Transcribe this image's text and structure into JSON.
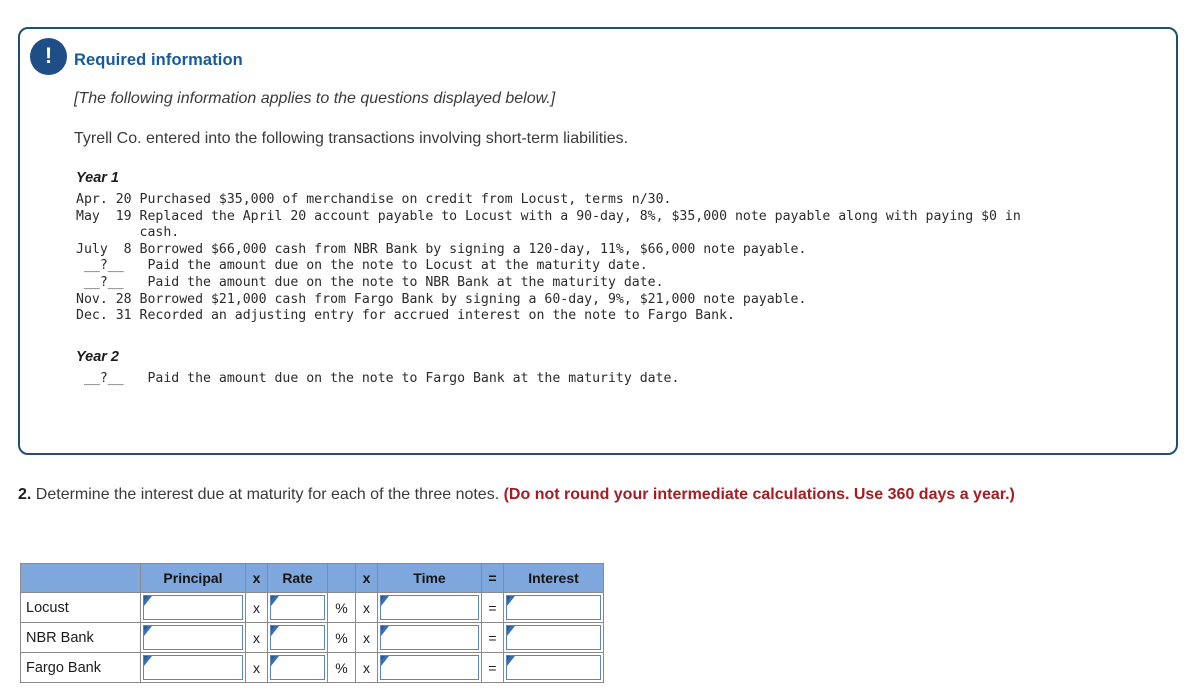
{
  "panel": {
    "alert_icon": "exclamation-icon",
    "heading": "Required information",
    "applies_note": "[The following information applies to the questions displayed below.]",
    "intro": "Tyrell Co. entered into the following transactions involving short-term liabilities.",
    "year1_heading": "Year 1",
    "year1_transactions": "Apr. 20 Purchased $35,000 of merchandise on credit from Locust, terms n/30.\nMay  19 Replaced the April 20 account payable to Locust with a 90-day, 8%, $35,000 note payable along with paying $0 in\n        cash.\nJuly  8 Borrowed $66,000 cash from NBR Bank by signing a 120-day, 11%, $66,000 note payable.\n __?__   Paid the amount due on the note to Locust at the maturity date.\n __?__   Paid the amount due on the note to NBR Bank at the maturity date.\nNov. 28 Borrowed $21,000 cash from Fargo Bank by signing a 60-day, 9%, $21,000 note payable.\nDec. 31 Recorded an adjusting entry for accrued interest on the note to Fargo Bank.",
    "year2_heading": "Year 2",
    "year2_transactions": " __?__   Paid the amount due on the note to Fargo Bank at the maturity date."
  },
  "question": {
    "number": "2.",
    "text": " Determine the interest due at maturity for each of the three notes. ",
    "hint": "(Do not round your intermediate calculations. Use 360 days a year.)"
  },
  "table": {
    "headers": {
      "row_label": "",
      "principal": "Principal",
      "times1": "x",
      "rate": "Rate",
      "percent": "",
      "times2": "x",
      "time": "Time",
      "equals": "=",
      "interest": "Interest"
    },
    "operators": {
      "times": "x",
      "percent": "%",
      "equals": "="
    },
    "rows": [
      {
        "label": "Locust",
        "principal": "",
        "rate": "",
        "time": "",
        "interest": ""
      },
      {
        "label": "NBR Bank",
        "principal": "",
        "rate": "",
        "time": "",
        "interest": ""
      },
      {
        "label": "Fargo Bank",
        "principal": "",
        "rate": "",
        "time": "",
        "interest": ""
      }
    ]
  },
  "colors": {
    "panel_border": "#1f4e79",
    "badge": "#1f4e87",
    "heading": "#17599c",
    "hint": "#a61c21",
    "table_header": "#7da7dd",
    "input_border": "#5a86bf"
  }
}
